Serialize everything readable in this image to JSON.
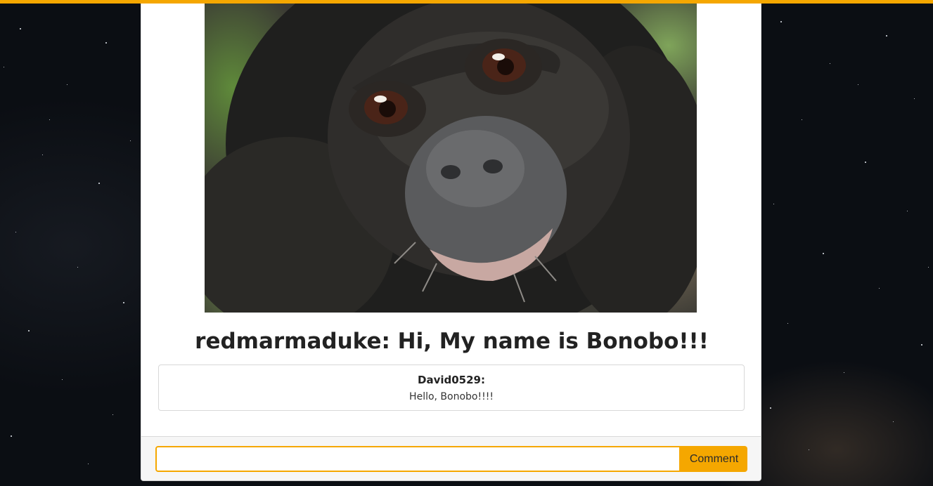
{
  "theme": {
    "accent": "#f5a700",
    "background": "#0b0e13",
    "card": "#ffffff"
  },
  "post": {
    "image": "bonobo-photo",
    "author": "redmarmaduke:",
    "text": " Hi, My name is Bonobo!!!"
  },
  "comments": [
    {
      "author": "David0529:",
      "text": "Hello, Bonobo!!!!"
    }
  ],
  "comment_form": {
    "input_value": "",
    "placeholder": "",
    "button_label": "Comment"
  }
}
